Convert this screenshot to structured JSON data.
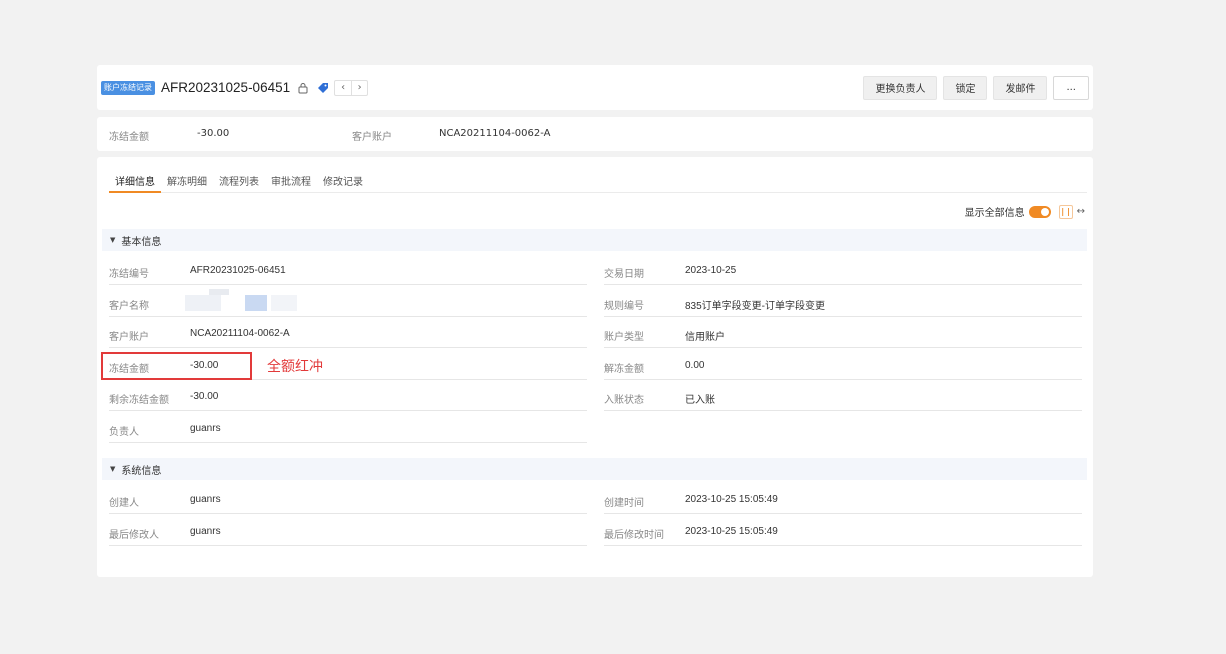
{
  "header": {
    "badge": "账户冻结记录",
    "record_id": "AFR20231025-06451",
    "actions": {
      "change_owner": "更换负责人",
      "lock": "锁定",
      "send_mail": "发邮件",
      "more": "..."
    }
  },
  "summary": {
    "frozen_amount_label": "冻结金额",
    "frozen_amount_value": "-30.00",
    "customer_account_label": "客户账户",
    "customer_account_value": "NCA20211104-0062-A"
  },
  "tabs": [
    "详细信息",
    "解冻明细",
    "流程列表",
    "审批流程",
    "修改记录"
  ],
  "toolbar": {
    "show_all_label": "显示全部信息"
  },
  "basic_info": {
    "title": "基本信息",
    "fields": {
      "freeze_no": {
        "label": "冻结编号",
        "value": "AFR20231025-06451"
      },
      "trade_date": {
        "label": "交易日期",
        "value": "2023-10-25"
      },
      "customer_name": {
        "label": "客户名称",
        "value": ""
      },
      "rule_no": {
        "label": "规则编号",
        "value": "835订单字段变更-订单字段变更"
      },
      "customer_account": {
        "label": "客户账户",
        "value": "NCA20211104-0062-A"
      },
      "account_type": {
        "label": "账户类型",
        "value": "信用账户"
      },
      "frozen_amount": {
        "label": "冻结金额",
        "value": "-30.00"
      },
      "unfrozen_amount": {
        "label": "解冻金额",
        "value": "0.00"
      },
      "remaining_frozen": {
        "label": "剩余冻结金额",
        "value": "-30.00"
      },
      "posting_status": {
        "label": "入账状态",
        "value": "已入账"
      },
      "owner": {
        "label": "负责人",
        "value": "guanrs"
      }
    }
  },
  "system_info": {
    "title": "系统信息",
    "fields": {
      "creator": {
        "label": "创建人",
        "value": "guanrs"
      },
      "created_at": {
        "label": "创建时间",
        "value": "2023-10-25 15:05:49"
      },
      "modifier": {
        "label": "最后修改人",
        "value": "guanrs"
      },
      "modified_at": {
        "label": "最后修改时间",
        "value": "2023-10-25 15:05:49"
      }
    }
  },
  "annotation": "全额红冲",
  "colors": {
    "accent": "#f08a24",
    "link": "#2f6fd6",
    "badge": "#4a90e2",
    "annotation": "#e23a3a"
  }
}
